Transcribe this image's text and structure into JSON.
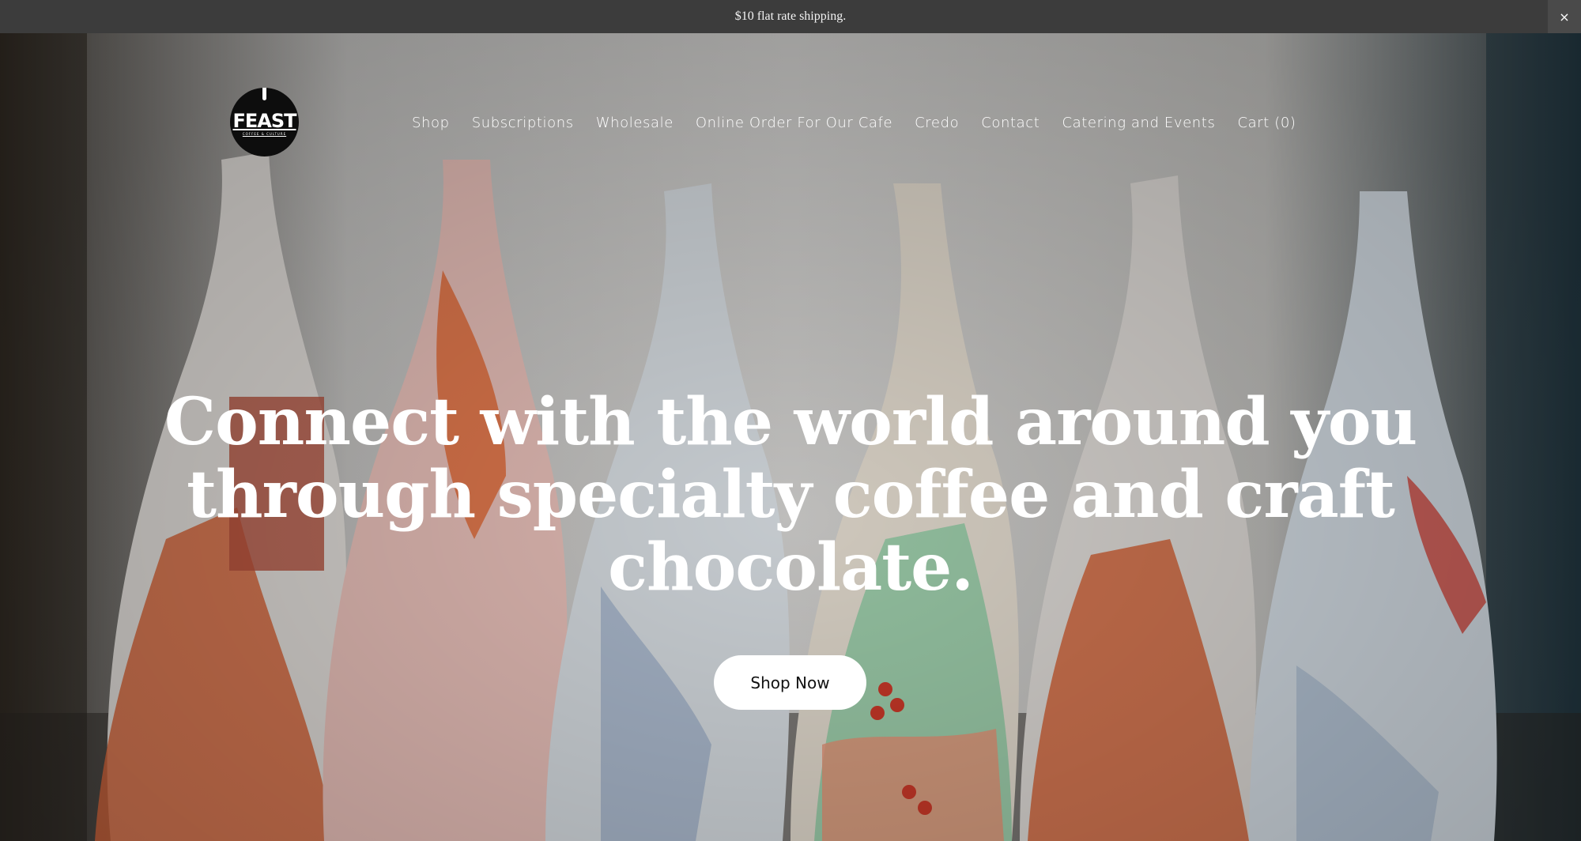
{
  "announcement": {
    "text": "$10 flat rate shipping.",
    "close_label": "×"
  },
  "logo": {
    "word": "FEAST",
    "tagline": "COFFEE & CULTURE"
  },
  "nav": {
    "items": [
      "Shop",
      "Subscriptions",
      "Wholesale",
      "Online Order For Our Cafe",
      "Credo",
      "Contact",
      "Catering and Events",
      "Cart (0)"
    ]
  },
  "hero": {
    "headline_lines": [
      "Connect with the world around you",
      "through specialty coffee and craft",
      "chocolate."
    ],
    "cta_label": "Shop Now"
  },
  "colors": {
    "announcement_bg": "#3c3c3c",
    "text_light": "#ffffff",
    "button_bg": "#ffffff"
  }
}
